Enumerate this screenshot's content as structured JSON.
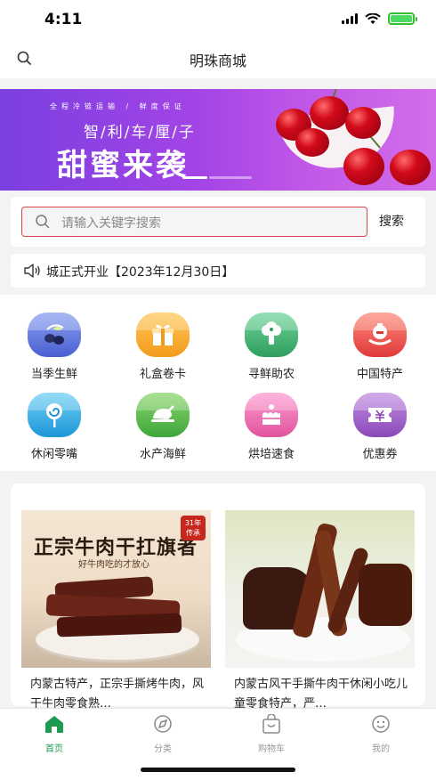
{
  "status_bar": {
    "time": "4:11"
  },
  "nav": {
    "title": "明珠商城"
  },
  "banner": {
    "subtitle": "全程冷链运输 / 鲜度保证",
    "tagline": "智/利/车/厘/子",
    "headline": "甜蜜来袭"
  },
  "search": {
    "placeholder": "请输入关键字搜索",
    "button_label": "搜索"
  },
  "notice": {
    "text": "城正式开业【2023年12月30日】"
  },
  "categories": [
    {
      "label": "当季生鲜",
      "icon": "olive-icon",
      "color": "#5b6fd8"
    },
    {
      "label": "礼盒卷卡",
      "icon": "gift-icon",
      "color": "#f5a623"
    },
    {
      "label": "寻鲜助农",
      "icon": "broccoli-icon",
      "color": "#3cb371"
    },
    {
      "label": "中国特产",
      "icon": "teapot-icon",
      "color": "#e84a4a"
    },
    {
      "label": "休闲零嘴",
      "icon": "lollipop-icon",
      "color": "#2aa7e0"
    },
    {
      "label": "水产海鲜",
      "icon": "roast-chicken-icon",
      "color": "#4caf50"
    },
    {
      "label": "烘培速食",
      "icon": "cake-icon",
      "color": "#e85aa5"
    },
    {
      "label": "优惠券",
      "icon": "coupon-icon",
      "color": "#9b59b6"
    }
  ],
  "products": [
    {
      "name": "内蒙古特产，正宗手撕烤牛肉，风干牛肉零食熟…",
      "image_title": "正宗牛肉干扛旗者",
      "image_slogan": "好牛肉吃的才放心",
      "image_badge_top": "31年",
      "image_badge_bottom": "传承"
    },
    {
      "name": "内蒙古风干手撕牛肉干休闲小吃儿童零食特产，严…"
    }
  ],
  "tabs": [
    {
      "label": "首页",
      "icon": "home-icon",
      "active": true
    },
    {
      "label": "分类",
      "icon": "compass-icon",
      "active": false
    },
    {
      "label": "购物车",
      "icon": "shopping-bag-icon",
      "active": false
    },
    {
      "label": "我的",
      "icon": "smiley-icon",
      "active": false
    }
  ],
  "colors": {
    "accent": "#1e9a52",
    "search_border": "#d9454c",
    "banner": "#a344e6"
  }
}
